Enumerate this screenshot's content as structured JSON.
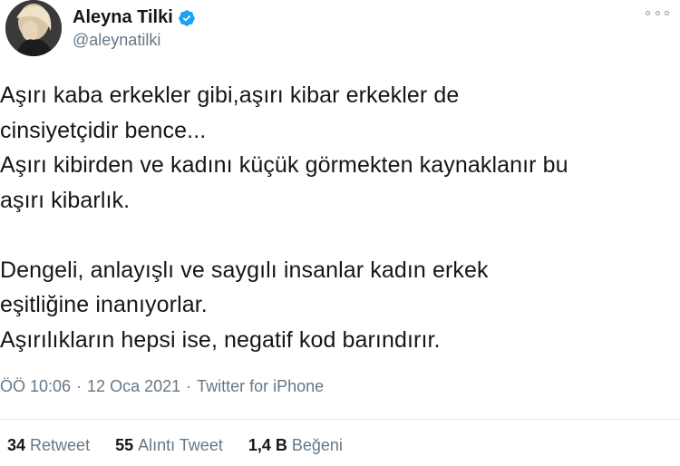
{
  "author": {
    "display_name": "Aleyna Tilki",
    "handle": "@aleynatilki",
    "verified": true
  },
  "tweet": {
    "lines": [
      "Aşırı kaba erkekler gibi,aşırı kibar erkekler de",
      "cinsiyetçidir bence...",
      "Aşırı kibirden ve kadını küçük görmekten kaynaklanır bu",
      "aşırı kibarlık.",
      "",
      "Dengeli, anlayışlı ve saygılı insanlar kadın erkek",
      "eşitliğine inanıyorlar.",
      "Aşırılıkların hepsi ise, negatif kod barındırır."
    ],
    "time": "ÖÖ 10:06",
    "date": "12 Oca 2021",
    "source": "Twitter for iPhone"
  },
  "stats": {
    "retweets_count": "34",
    "retweets_label": "Retweet",
    "quotes_count": "55",
    "quotes_label": "Alıntı Tweet",
    "likes_count": "1,4 B",
    "likes_label": "Beğeni"
  },
  "colors": {
    "text": "#14171a",
    "secondary": "#657786",
    "verified_blue": "#1da1f2",
    "divider": "#e1e8ed"
  },
  "icons": {
    "verified": "verified-badge-icon",
    "more": "more-options-icon"
  }
}
